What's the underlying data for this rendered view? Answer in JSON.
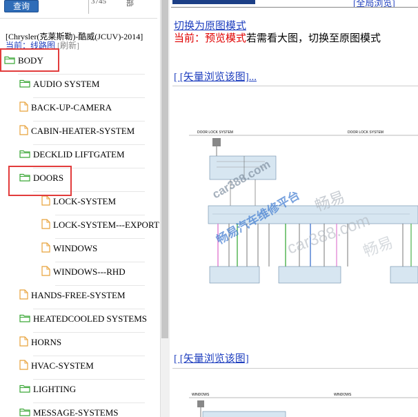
{
  "header": {
    "query_label": "查询",
    "page_count": "3745",
    "page_suffix": "部"
  },
  "car_title": "[Chrysler(克莱斯勒)-酷威(JCUV)-2014]",
  "current": {
    "label": "当前：线路图",
    "refresh": "[刷新]"
  },
  "tree": [
    {
      "label": "BODY",
      "type": "folder",
      "level": 0
    },
    {
      "label": "AUDIO SYSTEM",
      "type": "folder",
      "level": 1
    },
    {
      "label": "BACK-UP-CAMERA",
      "type": "file",
      "level": 1
    },
    {
      "label": "CABIN-HEATER-SYSTEM",
      "type": "file",
      "level": 1
    },
    {
      "label": "DECKLID LIFTGATEM",
      "type": "folder",
      "level": 1
    },
    {
      "label": "DOORS",
      "type": "folder",
      "level": 1
    },
    {
      "label": "LOCK-SYSTEM",
      "type": "file",
      "level": 2
    },
    {
      "label": "LOCK-SYSTEM---EXPORT",
      "type": "file",
      "level": 2
    },
    {
      "label": "WINDOWS",
      "type": "file",
      "level": 2
    },
    {
      "label": "WINDOWS---RHD",
      "type": "file",
      "level": 2
    },
    {
      "label": "HANDS-FREE-SYSTEM",
      "type": "file",
      "level": 1
    },
    {
      "label": "HEATEDCOOLED SYSTEMS",
      "type": "folder",
      "level": 1
    },
    {
      "label": "HORNS",
      "type": "file",
      "level": 1
    },
    {
      "label": "HVAC-SYSTEM",
      "type": "file",
      "level": 1
    },
    {
      "label": "LIGHTING",
      "type": "folder",
      "level": 1
    },
    {
      "label": "MESSAGE-SYSTEMS",
      "type": "folder",
      "level": 1
    }
  ],
  "content": {
    "top_right_link": "[全局浏览]",
    "switch_link": "切换为原图模式",
    "preview_prefix": "当前：预览模式",
    "preview_suffix": "若需看大图，切换至原图模式",
    "vector_link": "[ [矢量浏览该图]...",
    "vector_link_2": "[ [矢量浏览该图]",
    "diagram_1_titles": [
      "DOOR LOCK SYSTEM",
      "DOOR LOCK SYSTEM"
    ],
    "diagram_2_titles": [
      "WINDOWS",
      "WINDOWS"
    ]
  },
  "watermark": {
    "line1": "car388.com",
    "line2": "畅易汽车维修平台",
    "line3": "畅易",
    "line4": "car388.com",
    "line5": "畅易"
  },
  "colors": {
    "link": "#1f3fbf",
    "highlight_box": "#e23b3b",
    "preview_red": "#e00000",
    "folder_green": "#3aa636",
    "file_orange": "#e8a23a",
    "query_button": "#2f6db8"
  }
}
